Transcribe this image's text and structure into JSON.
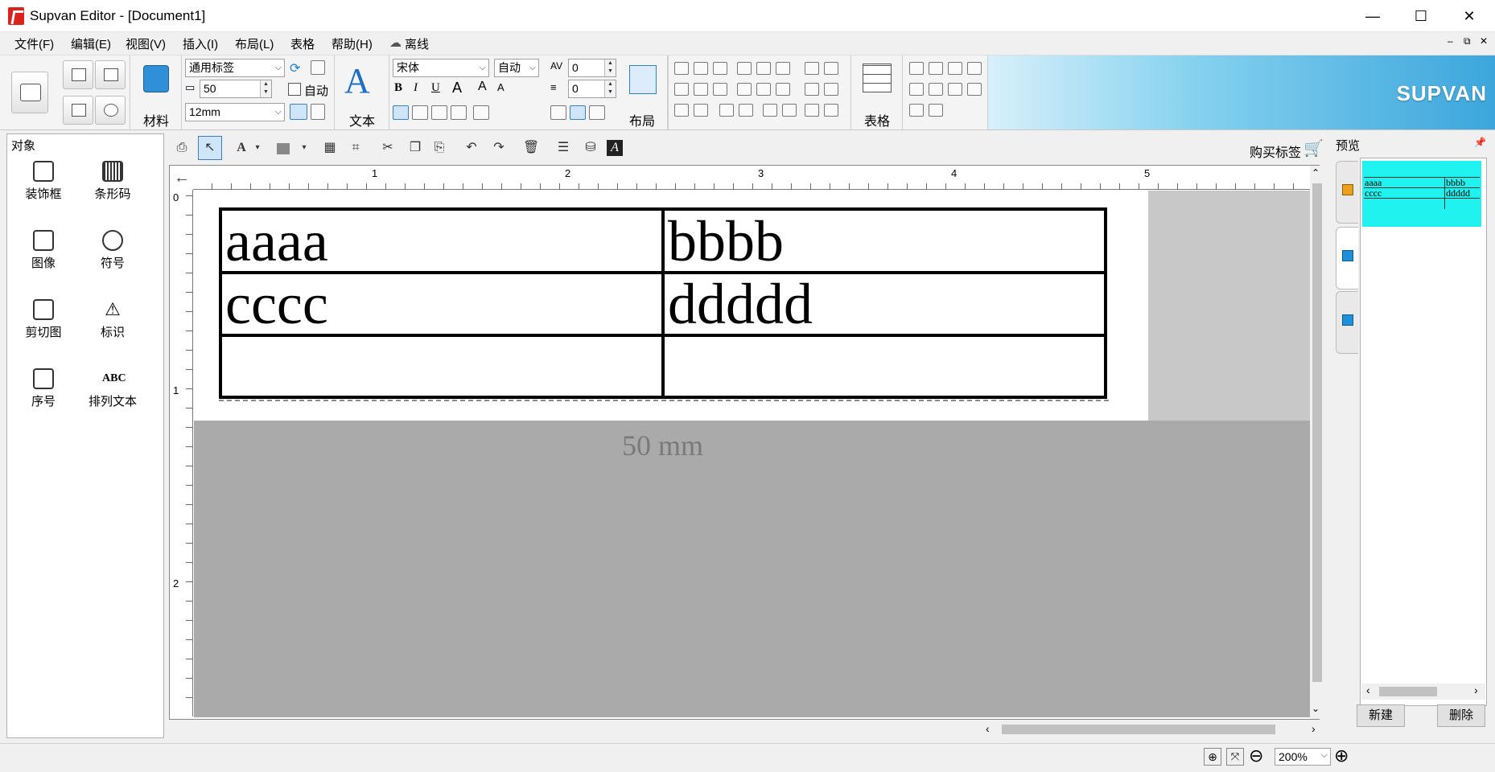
{
  "window": {
    "title": "Supvan Editor - [Document1]",
    "minimize": "—",
    "maximize": "☐",
    "close": "✕"
  },
  "menu": {
    "items": [
      "文件(F)",
      "编辑(E)",
      "视图(V)",
      "插入(I)",
      "布局(L)",
      "表格",
      "帮助(H)",
      "离线"
    ],
    "mdi": [
      "–",
      "⧉",
      "✕"
    ]
  },
  "ribbon": {
    "material_label": "材料",
    "label_type_value": "通用标签",
    "width_value": "50",
    "auto_label": "自动",
    "tape_value": "12mm",
    "text_label": "文本",
    "font_value": "宋体",
    "font_size_value": "自动",
    "char_spacing_value": "0",
    "line_spacing_value": "0",
    "layout_label": "布局",
    "table_label": "表格",
    "brand": "SUPVAN"
  },
  "objects": {
    "title": "对象",
    "items": [
      "装饰框",
      "条形码",
      "图像",
      "符号",
      "剪切图",
      "标识",
      "序号",
      "排列文本"
    ]
  },
  "toolbar2": {
    "buy_label": "购买标签"
  },
  "ruler": {
    "top_marks": [
      "1",
      "2",
      "3",
      "4",
      "5"
    ],
    "left_marks": [
      "0",
      "1",
      "2"
    ]
  },
  "label_table": {
    "rows": [
      [
        "aaaa",
        "bbbb"
      ],
      [
        "cccc",
        "ddddd"
      ],
      [
        "",
        ""
      ]
    ]
  },
  "size_label": "50  mm",
  "preview": {
    "title": "预览",
    "thumb_rows": [
      [
        "aaaa",
        "bbbb"
      ],
      [
        "cccc",
        "ddddd"
      ]
    ],
    "new_label": "新建",
    "delete_label": "删除"
  },
  "status": {
    "zoom_value": "200%"
  }
}
